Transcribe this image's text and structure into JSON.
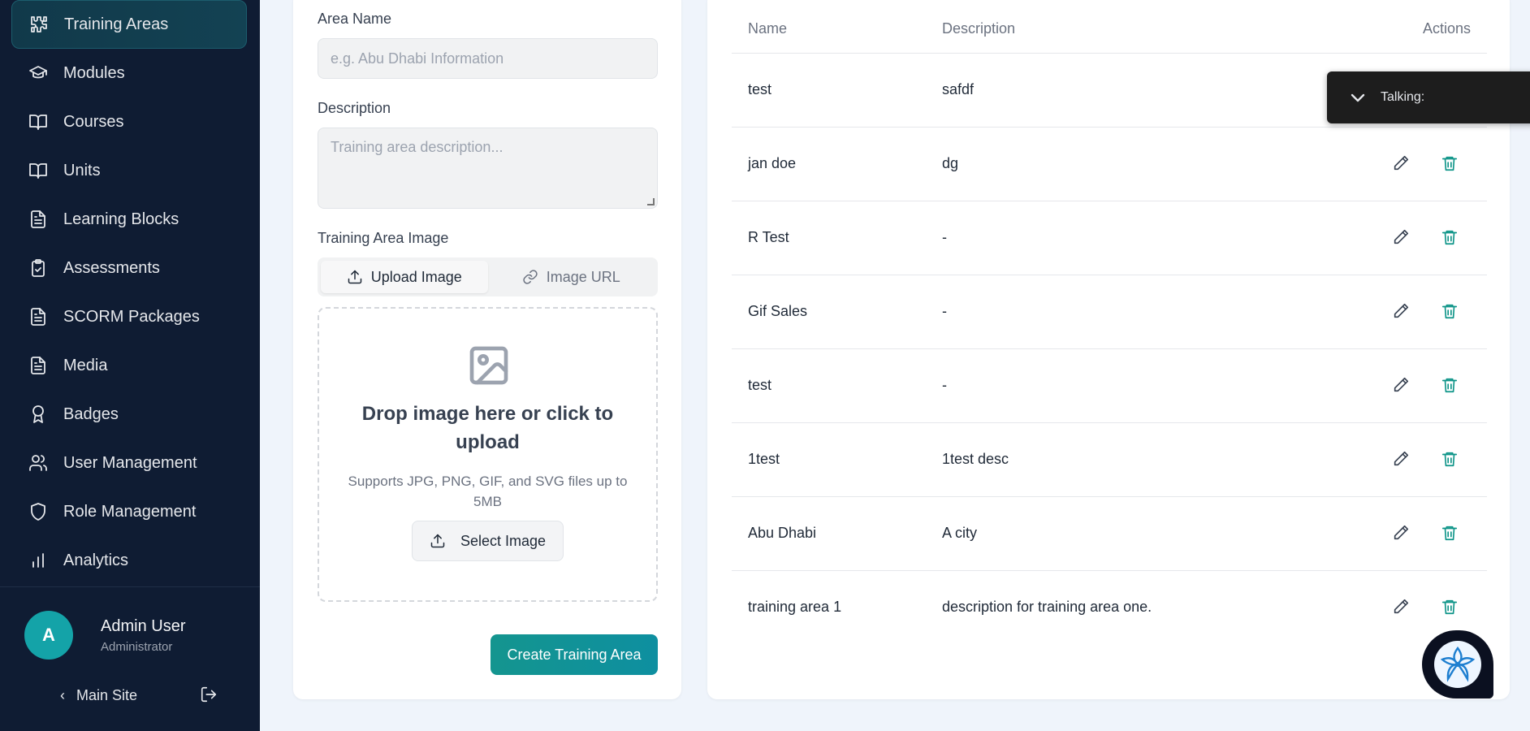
{
  "sidebar": {
    "items": [
      {
        "label": "Training Areas",
        "icon": "puzzle-icon",
        "active": true
      },
      {
        "label": "Modules",
        "icon": "graduation-cap-icon"
      },
      {
        "label": "Courses",
        "icon": "book-open-icon"
      },
      {
        "label": "Units",
        "icon": "book-open-icon"
      },
      {
        "label": "Learning Blocks",
        "icon": "document-icon"
      },
      {
        "label": "Assessments",
        "icon": "clipboard-check-icon"
      },
      {
        "label": "SCORM Packages",
        "icon": "document-icon"
      },
      {
        "label": "Media",
        "icon": "document-icon"
      },
      {
        "label": "Badges",
        "icon": "award-icon"
      },
      {
        "label": "User Management",
        "icon": "users-icon"
      },
      {
        "label": "Role Management",
        "icon": "shield-icon"
      },
      {
        "label": "Analytics",
        "icon": "bar-chart-icon"
      }
    ],
    "user": {
      "initial": "A",
      "name": "Admin User",
      "role": "Administrator"
    },
    "main_site_label": "Main Site"
  },
  "form": {
    "area_name_label": "Area Name",
    "area_name_placeholder": "e.g. Abu Dhabi Information",
    "description_label": "Description",
    "description_placeholder": "Training area description...",
    "image_label": "Training Area Image",
    "tab_upload": "Upload Image",
    "tab_url": "Image URL",
    "dropzone_title": "Drop image here or click to upload",
    "dropzone_sub": "Supports JPG, PNG, GIF, and SVG files up to 5MB",
    "select_button": "Select Image",
    "create_button": "Create Training Area"
  },
  "table": {
    "headers": {
      "name": "Name",
      "description": "Description",
      "actions": "Actions"
    },
    "rows": [
      {
        "name": "test",
        "description": "safdf"
      },
      {
        "name": "jan doe",
        "description": "dg"
      },
      {
        "name": "R Test",
        "description": "-"
      },
      {
        "name": "Gif Sales",
        "description": "-"
      },
      {
        "name": "test",
        "description": "-"
      },
      {
        "name": "1test",
        "description": "1test desc"
      },
      {
        "name": "Abu Dhabi",
        "description": "A city"
      },
      {
        "name": "training area 1",
        "description": "description for training area one."
      }
    ]
  },
  "overlay": {
    "talking_label": "Talking:"
  },
  "colors": {
    "sidebar_bg": "#0f1c33",
    "accent": "#14958f",
    "avatar": "#14a3a8",
    "delete_icon": "#0d9488"
  }
}
